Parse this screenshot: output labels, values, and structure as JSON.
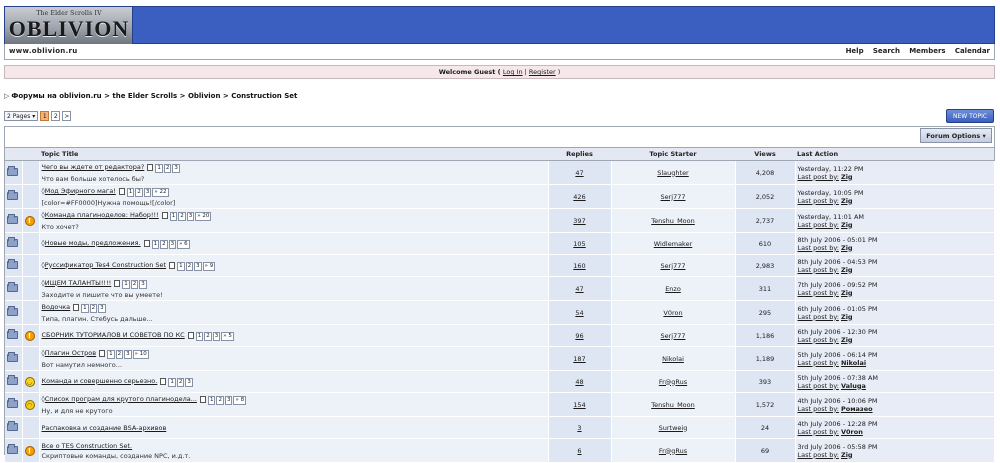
{
  "header": {
    "logo_sub": "The Elder Scrolls IV",
    "logo_main": "OBLIVION",
    "site_url": "www.oblivion.ru",
    "nav": [
      "Help",
      "Search",
      "Members",
      "Calendar"
    ]
  },
  "welcome": {
    "prefix": "Welcome Guest ( ",
    "login": "Log In",
    "sep": " | ",
    "register": "Register",
    "suffix": " )"
  },
  "breadcrumb": {
    "arrow": "▷",
    "items": [
      "Форумы на oblivion.ru",
      "the Elder Scrolls",
      "Oblivion",
      "Construction Set"
    ],
    "sep": " > "
  },
  "pagination": {
    "pages_label": "2 Pages ▾",
    "pages": [
      "1",
      "2"
    ],
    "current": "1",
    "next": ">"
  },
  "new_topic_label": "NEW TOPIC",
  "forum_options_label": "Forum Options ▾",
  "columns": {
    "title": "Topic Title",
    "replies": "Replies",
    "starter": "Topic Starter",
    "views": "Views",
    "last_action": "Last Action"
  },
  "last_post_label": "Last post by:",
  "topics": [
    {
      "icon": "none",
      "pinned": false,
      "title": "Чего вы ждете от редактора?",
      "pages": [
        "1",
        "2",
        "3"
      ],
      "desc": "Что вам больше хотелось бы?",
      "replies": "47",
      "starter": "Slaughter",
      "views": "4,208",
      "date": "Yesterday, 11:22 PM",
      "last_by": "Zig"
    },
    {
      "icon": "none",
      "pinned": true,
      "title": "Мод Эфирного мага!",
      "pages": [
        "1",
        "2",
        "3",
        "» 22"
      ],
      "desc": "[color=#FF0000]Нужна помощь![/color]",
      "replies": "426",
      "starter": "Serj777",
      "views": "2,052",
      "date": "Yesterday, 10:05 PM",
      "last_by": "Zig"
    },
    {
      "icon": "warn",
      "pinned": true,
      "title": "Команда плагиноделов: Набор!!!",
      "pages": [
        "1",
        "2",
        "3",
        "» 20"
      ],
      "desc": "Кто хочет?",
      "replies": "397",
      "starter": "Tenshu_Moon",
      "views": "2,737",
      "date": "Yesterday, 11:01 AM",
      "last_by": "Zig"
    },
    {
      "icon": "none",
      "pinned": true,
      "title": "Новые моды, предложения.",
      "pages": [
        "1",
        "2",
        "3",
        "» 6"
      ],
      "desc": "",
      "replies": "105",
      "starter": "Widlemaker",
      "views": "610",
      "date": "8th July 2006 - 05:01 PM",
      "last_by": "Zig"
    },
    {
      "icon": "none",
      "pinned": true,
      "title": "Руссификатор Tes4 Construction Set",
      "pages": [
        "1",
        "2",
        "3",
        "» 9"
      ],
      "desc": "",
      "replies": "160",
      "starter": "Serj777",
      "views": "2,983",
      "date": "8th July 2006 - 04:53 PM",
      "last_by": "Zig"
    },
    {
      "icon": "none",
      "pinned": true,
      "title": "ИЩЕМ ТАЛАНТЫ!!!!",
      "pages": [
        "1",
        "2",
        "3"
      ],
      "desc": "Заходите и пишите что вы умеете!",
      "replies": "47",
      "starter": "Enzo",
      "views": "311",
      "date": "7th July 2006 - 09:52 PM",
      "last_by": "Zig"
    },
    {
      "icon": "none",
      "pinned": false,
      "title": "Водочка",
      "pages": [
        "1",
        "2",
        "3"
      ],
      "desc": "Типа, плагин. Стебусь дальше...",
      "replies": "54",
      "starter": "V0ron",
      "views": "295",
      "date": "6th July 2006 - 01:05 PM",
      "last_by": "Zig"
    },
    {
      "icon": "warn",
      "pinned": false,
      "title": "СБОРНИК ТУТОРИАЛОВ И СОВЕТОВ ПО КС",
      "pages": [
        "1",
        "2",
        "3",
        "» 5"
      ],
      "desc": "",
      "replies": "96",
      "starter": "Serj777",
      "views": "1,186",
      "date": "6th July 2006 - 12:30 PM",
      "last_by": "Zig"
    },
    {
      "icon": "none",
      "pinned": true,
      "title": "Плагин Остров",
      "pages": [
        "1",
        "2",
        "3",
        "» 10"
      ],
      "desc": "Вот намутил немного...",
      "replies": "187",
      "starter": "Nikolai",
      "views": "1,189",
      "date": "5th July 2006 - 06:14 PM",
      "last_by": "Nikolai"
    },
    {
      "icon": "smile_a",
      "pinned": false,
      "title": "Команда и совершенно серьезно.",
      "pages": [
        "1",
        "2",
        "3"
      ],
      "desc": "",
      "replies": "48",
      "starter": "Fr@gRus",
      "views": "393",
      "date": "5th July 2006 - 07:38 AM",
      "last_by": "Valuga"
    },
    {
      "icon": "smile_b",
      "pinned": true,
      "title": "Список програм для крутого плагинодела...",
      "pages": [
        "1",
        "2",
        "3",
        "» 8"
      ],
      "desc": "Ну, и для не крутого",
      "replies": "154",
      "starter": "Tenshu_Moon",
      "views": "1,572",
      "date": "4th July 2006 - 10:06 PM",
      "last_by": "Ромазео"
    },
    {
      "icon": "none",
      "pinned": false,
      "title": "Распаковка и создание BSA-архивов",
      "pages": [],
      "desc": "",
      "replies": "3",
      "starter": "Surtweig",
      "views": "24",
      "date": "4th July 2006 - 12:28 PM",
      "last_by": "V0ron"
    },
    {
      "icon": "warn",
      "pinned": false,
      "title": "Все о TES Construction Set.",
      "pages": [],
      "desc": "Скриптовые команды, создание NPC, и.д.т.",
      "replies": "6",
      "starter": "Fr@gRus",
      "views": "69",
      "date": "3rd July 2006 - 05:58 PM",
      "last_by": "Zig"
    }
  ]
}
